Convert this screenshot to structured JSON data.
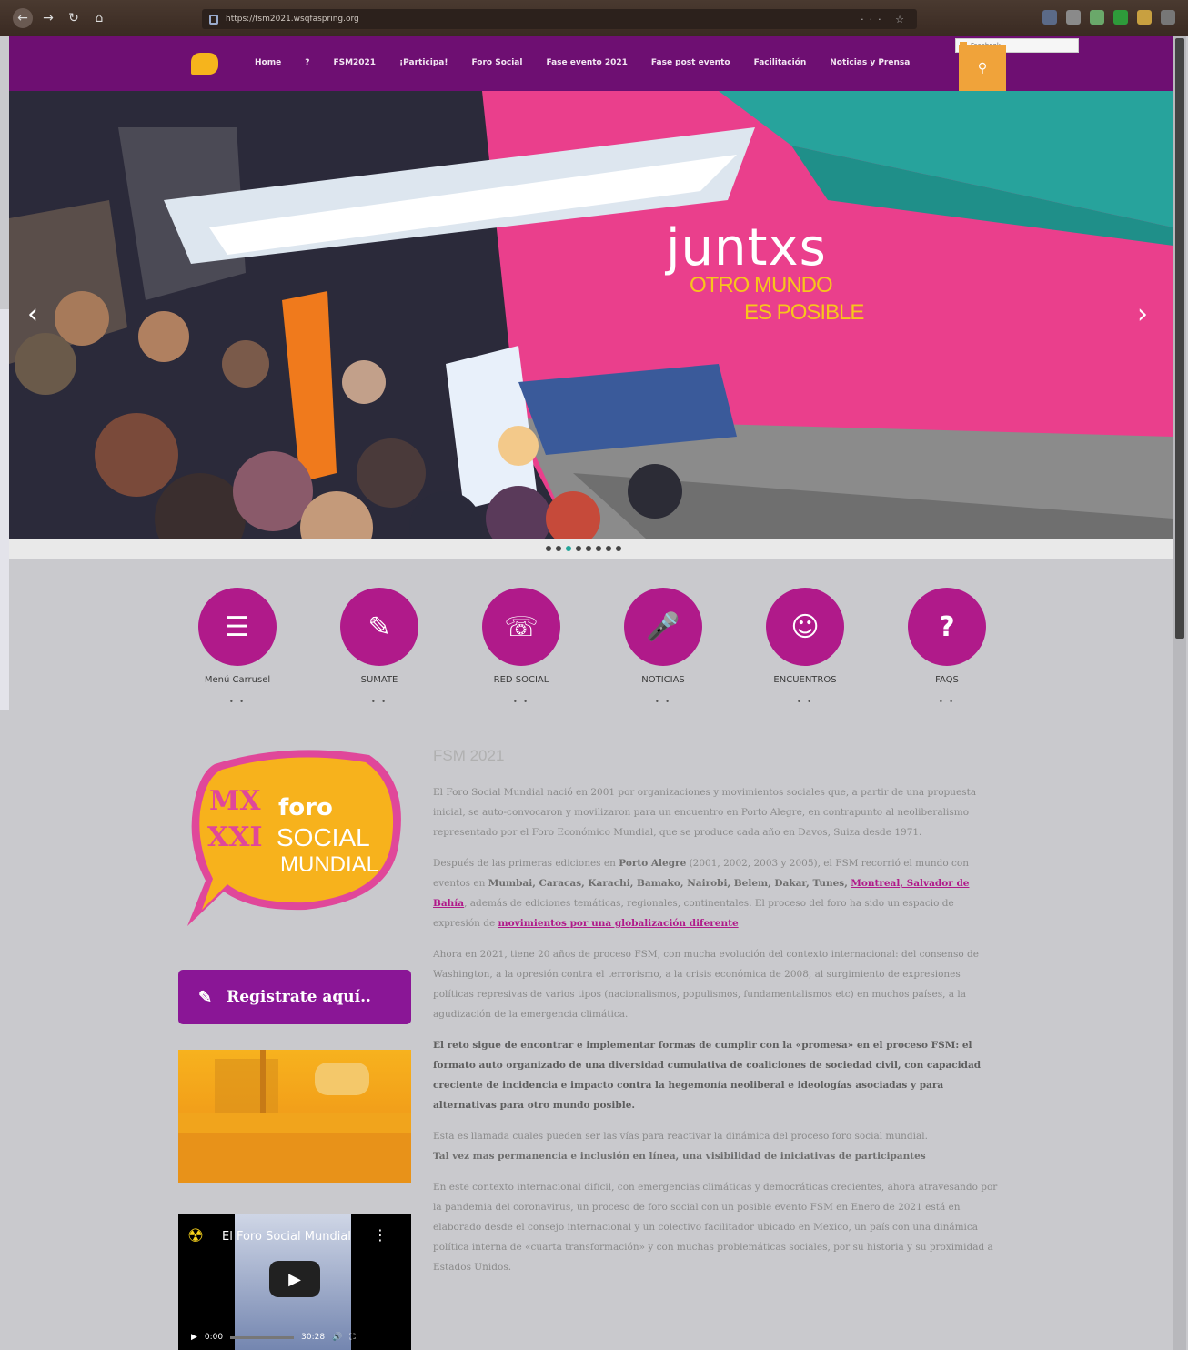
{
  "browser": {
    "url": "https://fsm2021.wsqfaspring.org"
  },
  "nav": {
    "items": [
      "Home",
      "?",
      "FSM2021",
      "¡Participa!",
      "Foro Social",
      "Fase evento 2021",
      "Fase post evento",
      "Facilitación",
      "Noticias y Prensa"
    ],
    "facebook_label": "Facebook"
  },
  "hero": {
    "title": "juntxs",
    "subtitle_line1": "OTRO MUNDO",
    "subtitle_line2": "ES POSIBLE",
    "slide_count": 8,
    "active_slide": 3
  },
  "features": [
    {
      "label": "Menú Carrusel",
      "icon": "list-icon"
    },
    {
      "label": "SUMATE",
      "icon": "pencil-icon"
    },
    {
      "label": "RED SOCIAL",
      "icon": "whatsapp-icon"
    },
    {
      "label": "NOTICIAS",
      "icon": "microphone-icon"
    },
    {
      "label": "ENCUENTROS",
      "icon": "users-icon"
    },
    {
      "label": "FAQS",
      "icon": "question-icon"
    }
  ],
  "sidebar": {
    "logo_text_1": "foro",
    "logo_text_2": "SOCIAL",
    "logo_text_3": "MUNDIAL",
    "register_label": "Registrate aquí..",
    "video_title": "El Foro Social Mundial",
    "video_time": "0:00",
    "video_duration": "30:28"
  },
  "article": {
    "title": "FSM 2021",
    "p1": "El Foro Social Mundial nació en 2001 por organizaciones y movimientos sociales que, a partir de una propuesta inicial, se auto-convocaron y movilizaron para un encuentro en Porto Alegre, en contrapunto al neoliberalismo representado por el Foro Económico Mundial, que se produce cada año en Davos, Suiza desde 1971.",
    "p2_a": "Después de las primeras ediciones en ",
    "p2_b": "Porto Alegre",
    "p2_c": " (2001, 2002, 2003 y 2005), el FSM recorrió el mundo con eventos en ",
    "p2_d": "Mumbai, Caracas, Karachi, Bamako, Nairobi, Belem, Dakar, Tunes,",
    "p2_link1": "Montreal, Salvador de Bahía",
    "p2_e": ", además de ediciones temáticas, regionales, continentales. El proceso del foro ha sido un espacio de expresión de ",
    "p2_link2": "movimientos por una globalización diferente",
    "p3": "Ahora en 2021, tiene 20 años de proceso FSM, con mucha evolución del contexto internacional: del consenso de Washington, a la opresión contra el terrorismo, a la crisis económica de 2008, al surgimiento de expresiones políticas represivas de varios tipos (nacionalismos, populismos, fundamentalismos etc) en muchos países, a la agudización de la emergencia climática.",
    "p4": "El reto sigue de encontrar e implementar formas de cumplir con la «promesa» en el proceso FSM: el formato auto organizado de una diversidad cumulativa de coaliciones de sociedad civil, con capacidad creciente de incidencia e impacto contra la hegemonía neoliberal e ideologías asociadas y para alternativas para otro mundo posible.",
    "p5": "Esta es llamada cuales pueden ser las vías para reactivar la dinámica del proceso foro social mundial.",
    "p5_bold": "Tal vez mas permanencia e inclusión en línea, una visibilidad de iniciativas de participantes",
    "p6": "En este contexto internacional difícil, con emergencias climáticas y democráticas crecientes, ahora atravesando por la pandemia del coronavirus, un proceso de foro social con un posible evento FSM en Enero de 2021 está en elaborado desde el consejo internacional y un colectivo facilitador ubicado en Mexico, un país con una dinámica política interna de «cuarta transformación» y con muchas problemáticas sociales, por su historia y su proximidad a Estados Unidos."
  },
  "colors": {
    "header": "#6e0f72",
    "accent": "#b01a8a",
    "hero_pink": "#ea3f8c",
    "hero_teal": "#27a39c",
    "search": "#f0a33a"
  }
}
